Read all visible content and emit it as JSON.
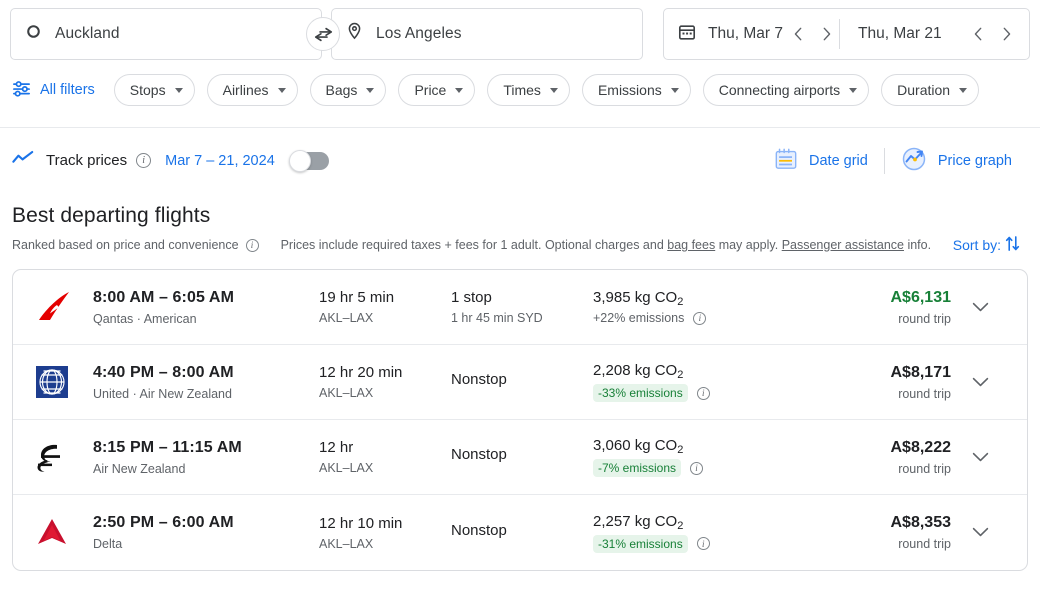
{
  "search": {
    "origin": "Auckland",
    "destination": "Los Angeles",
    "origin_icon": "circle-outline-icon",
    "destination_icon": "location-pin-icon",
    "swap_icon": "swap-horizontal-icon",
    "calendar_icon": "calendar-icon",
    "depart_date": "Thu, Mar 7",
    "return_date": "Thu, Mar 21"
  },
  "filters": {
    "all_filters_label": "All filters",
    "all_filters_icon": "tune-icon",
    "chips": [
      {
        "label": "Stops"
      },
      {
        "label": "Airlines"
      },
      {
        "label": "Bags"
      },
      {
        "label": "Price"
      },
      {
        "label": "Times"
      },
      {
        "label": "Emissions"
      },
      {
        "label": "Connecting airports"
      },
      {
        "label": "Duration"
      }
    ]
  },
  "track": {
    "icon": "trending-line-icon",
    "label": "Track prices",
    "date_range": "Mar 7 – 21, 2024",
    "toggle_state": "off",
    "date_grid_label": "Date grid",
    "date_grid_icon": "calendar-grid-icon",
    "price_graph_label": "Price graph",
    "price_graph_icon": "price-graph-icon"
  },
  "results_header": {
    "title": "Best departing flights",
    "ranked_note": "Ranked based on price and convenience",
    "disclaimer_pre": "Prices include required taxes + fees for 1 adult. Optional charges and ",
    "disclaimer_link1": "bag fees",
    "disclaimer_mid": " may apply. ",
    "disclaimer_link2": "Passenger assistance",
    "disclaimer_post": " info.",
    "sort_by_label": "Sort by:",
    "sort_icon": "sort-arrows-icon"
  },
  "flights": [
    {
      "airline_logo": "qantas-logo",
      "times": "8:00 AM – 6:05 AM",
      "airlines": "Qantas · American",
      "duration": "19 hr 5 min",
      "route": "AKL–LAX",
      "stops": "1 stop",
      "stop_detail": "1 hr 45 min SYD",
      "co2": "3,985 kg CO",
      "co2_sub": "2",
      "emissions": "+22% emissions",
      "emissions_style": "plain",
      "price": "A$6,131",
      "price_style": "deal",
      "price_note": "round trip"
    },
    {
      "airline_logo": "united-logo",
      "times": "4:40 PM – 8:00 AM",
      "airlines": "United · Air New Zealand",
      "duration": "12 hr 20 min",
      "route": "AKL–LAX",
      "stops": "Nonstop",
      "stop_detail": "",
      "co2": "2,208 kg CO",
      "co2_sub": "2",
      "emissions": "-33% emissions",
      "emissions_style": "badge",
      "price": "A$8,171",
      "price_style": "normal",
      "price_note": "round trip"
    },
    {
      "airline_logo": "air-new-zealand-logo",
      "times": "8:15 PM – 11:15 AM",
      "airlines": "Air New Zealand",
      "duration": "12 hr",
      "route": "AKL–LAX",
      "stops": "Nonstop",
      "stop_detail": "",
      "co2": "3,060 kg CO",
      "co2_sub": "2",
      "emissions": "-7% emissions",
      "emissions_style": "badge",
      "price": "A$8,222",
      "price_style": "normal",
      "price_note": "round trip"
    },
    {
      "airline_logo": "delta-logo",
      "times": "2:50 PM – 6:00 AM",
      "airlines": "Delta",
      "duration": "12 hr 10 min",
      "route": "AKL–LAX",
      "stops": "Nonstop",
      "stop_detail": "",
      "co2": "2,257 kg CO",
      "co2_sub": "2",
      "emissions": "-31% emissions",
      "emissions_style": "badge",
      "price": "A$8,353",
      "price_style": "normal",
      "price_note": "round trip"
    }
  ],
  "colors": {
    "accent_blue": "#1a73e8",
    "deal_green": "#188038",
    "badge_bg": "#e6f4ea",
    "border": "#dadce0"
  }
}
